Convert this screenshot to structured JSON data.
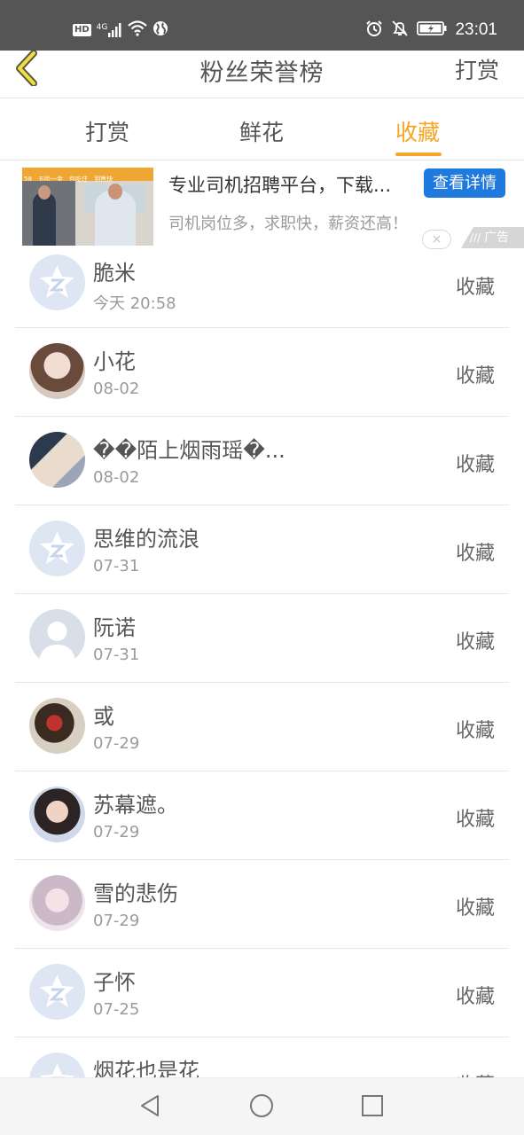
{
  "status_bar": {
    "left_badges": [
      "HD",
      "4G"
    ],
    "time": "23:01",
    "icons": [
      "signal-icon",
      "wifi-icon",
      "globe-icon",
      "alarm-icon",
      "mute-icon",
      "battery-icon"
    ]
  },
  "header": {
    "back_icon": "chevron-left-icon",
    "title": "粉丝荣誉榜",
    "action": "打赏"
  },
  "tabs": [
    {
      "label": "打赏",
      "active": false
    },
    {
      "label": "鲜花",
      "active": false
    },
    {
      "label": "收藏",
      "active": true
    }
  ],
  "ad": {
    "banner_text": [
      "58",
      "五险一金",
      "包吃住",
      "到售快"
    ],
    "title": "专业司机招聘平台，下载...",
    "detail_button": "查看详情",
    "description": "司机岗位多，求职快，薪资还高！",
    "close": "×",
    "tag": "广告"
  },
  "list": [
    {
      "name": "脆米",
      "date": "今天 20:58",
      "action": "收藏",
      "avatar": "default-avatar"
    },
    {
      "name": "小花",
      "date": "08-02",
      "action": "收藏",
      "avatar": "photo"
    },
    {
      "name": "��陌上烟雨瑶�...",
      "date": "08-02",
      "action": "收藏",
      "avatar": "photo"
    },
    {
      "name": "思维的流浪",
      "date": "07-31",
      "action": "收藏",
      "avatar": "default-avatar"
    },
    {
      "name": "阮诺",
      "date": "07-31",
      "action": "收藏",
      "avatar": "person-silhouette"
    },
    {
      "name": "或",
      "date": "07-29",
      "action": "收藏",
      "avatar": "photo"
    },
    {
      "name": "苏幕遮。",
      "date": "07-29",
      "action": "收藏",
      "avatar": "photo"
    },
    {
      "name": "雪的悲伤",
      "date": "07-29",
      "action": "收藏",
      "avatar": "photo"
    },
    {
      "name": "子怀",
      "date": "07-25",
      "action": "收藏",
      "avatar": "default-avatar"
    },
    {
      "name": "烟花也是花",
      "date": "",
      "action": "收藏",
      "avatar": "default-avatar"
    }
  ],
  "nav_bar": {
    "icons": [
      "back-triangle-icon",
      "home-circle-icon",
      "recents-square-icon"
    ]
  },
  "colors": {
    "accent": "#f5a623",
    "ad_button": "#1f7ae0",
    "status_bar": "#555555"
  }
}
